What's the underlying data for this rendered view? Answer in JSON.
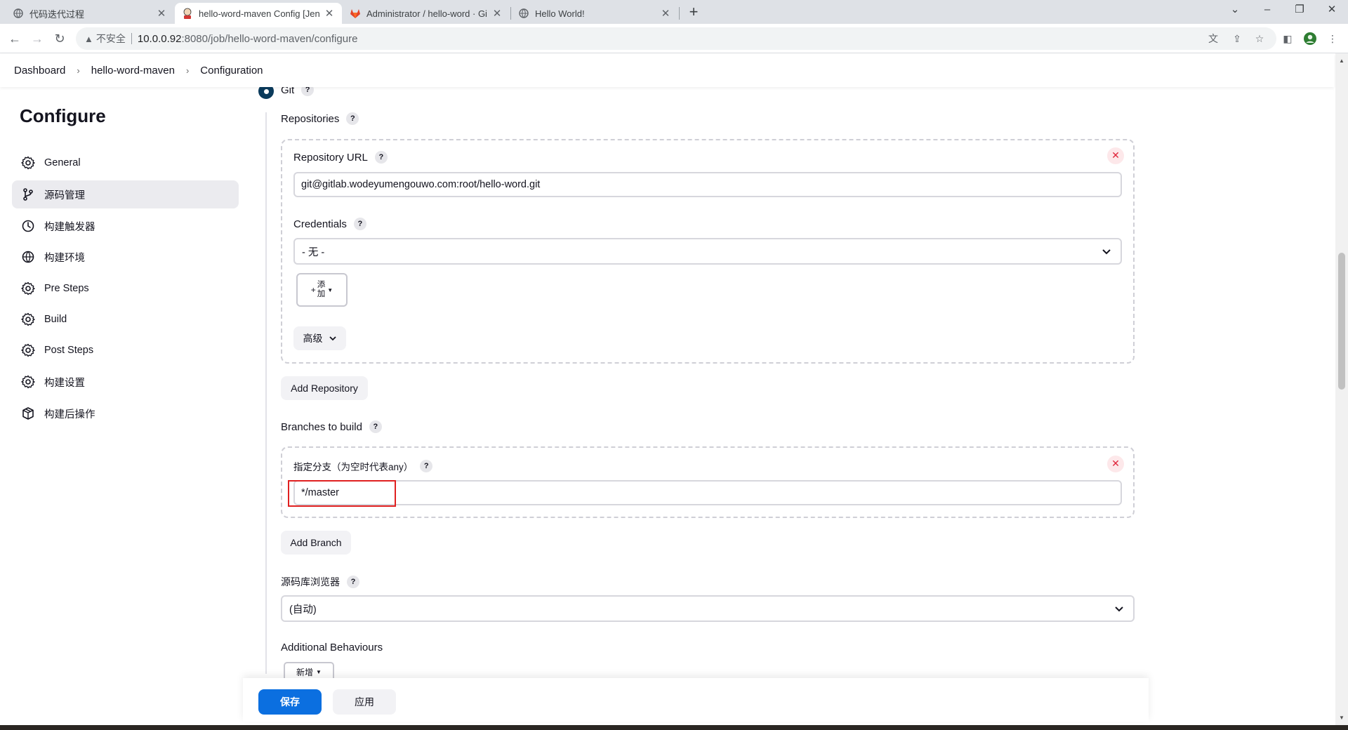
{
  "browser": {
    "tabs": [
      {
        "title": "代码迭代过程"
      },
      {
        "title": "hello-word-maven Config [Jenkins]"
      },
      {
        "title": "Administrator / hello-word · GitLab"
      },
      {
        "title": "Hello World!"
      }
    ],
    "address": {
      "security_label": "不安全",
      "host": "10.0.0.92",
      "path": ":8080/job/hello-word-maven/configure"
    }
  },
  "breadcrumb": {
    "items": [
      "Dashboard",
      "hello-word-maven",
      "Configuration"
    ]
  },
  "sidebar": {
    "title": "Configure",
    "items": [
      {
        "label": "General",
        "icon": "gear-icon"
      },
      {
        "label": "源码管理",
        "icon": "branch-icon",
        "active": true
      },
      {
        "label": "构建触发器",
        "icon": "clock-icon"
      },
      {
        "label": "构建环境",
        "icon": "globe-icon"
      },
      {
        "label": "Pre Steps",
        "icon": "gear-icon"
      },
      {
        "label": "Build",
        "icon": "gear-icon"
      },
      {
        "label": "Post Steps",
        "icon": "gear-icon"
      },
      {
        "label": "构建设置",
        "icon": "gear-icon"
      },
      {
        "label": "构建后操作",
        "icon": "package-icon"
      }
    ]
  },
  "scm": {
    "git_label": "Git",
    "repositories_label": "Repositories",
    "repository_url_label": "Repository URL",
    "repository_url_value": "git@gitlab.wodeyumengouwo.com:root/hello-word.git",
    "credentials_label": "Credentials",
    "credentials_value": "- 无 -",
    "add_button": {
      "line1": "添",
      "line2": "加"
    },
    "advanced_label": "高级",
    "add_repository_label": "Add Repository",
    "branches_label": "Branches to build",
    "branch_spec_label": "指定分支（为空时代表any）",
    "branch_spec_value": "*/master",
    "add_branch_label": "Add Branch",
    "repo_browser_label": "源码库浏览器",
    "repo_browser_value": "(自动)",
    "additional_behaviours_label": "Additional Behaviours",
    "new_button_label": "新增"
  },
  "actions": {
    "save_label": "保存",
    "apply_label": "应用"
  },
  "colors": {
    "primary": "#0b6fe0",
    "highlight": "#e02020",
    "radio": "#0b3b5c"
  }
}
